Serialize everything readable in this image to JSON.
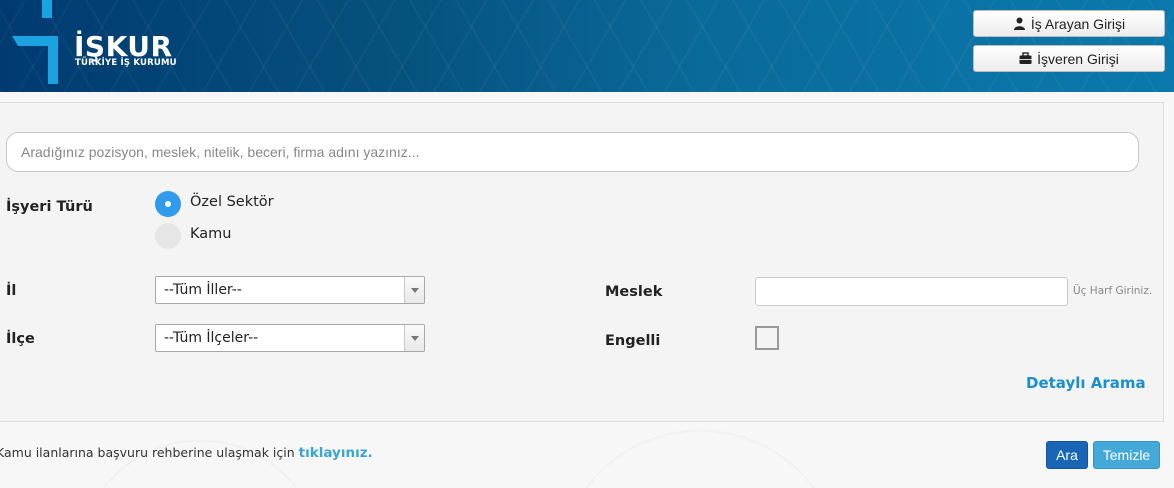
{
  "header": {
    "logo_text": "İŞKUR",
    "logo_subtitle": "TÜRKİYE İŞ KURUMU",
    "jobseeker_login_label": "İş Arayan Girişi",
    "employer_login_label": "İşveren Girişi",
    "colors": {
      "header_dark": "#003a70",
      "header_light": "#0b79ad",
      "logo_accent": "#1aa3e0"
    },
    "icons": {
      "jobseeker": "user-icon",
      "employer": "briefcase-icon"
    }
  },
  "search": {
    "placeholder": "Aradığınız pozisyon, meslek, nitelik, beceri, firma adını yazınız..."
  },
  "workplace_type": {
    "label": "İşyeri Türü",
    "options": [
      {
        "label": "Özel Sektör",
        "checked": true
      },
      {
        "label": "Kamu",
        "checked": false
      }
    ]
  },
  "province": {
    "label": "İl",
    "selected": "--Tüm İller--"
  },
  "district": {
    "label": "İlçe",
    "selected": "--Tüm İlçeler--"
  },
  "occupation": {
    "label": "Meslek",
    "value": "",
    "hint": "Üç Harf Giriniz."
  },
  "disabled": {
    "label": "Engelli",
    "checked": false
  },
  "detailed_search_label": "Detaylı Arama",
  "footer": {
    "info_text": "Kamu ilanlarına başvuru rehberine ulaşmak için",
    "info_link": "tıklayınız.",
    "search_button": "Ara",
    "clear_button": "Temizle",
    "colors": {
      "search_button": "#1a66b6",
      "clear_button": "#44a8d8",
      "link": "#1a8ed0"
    }
  }
}
